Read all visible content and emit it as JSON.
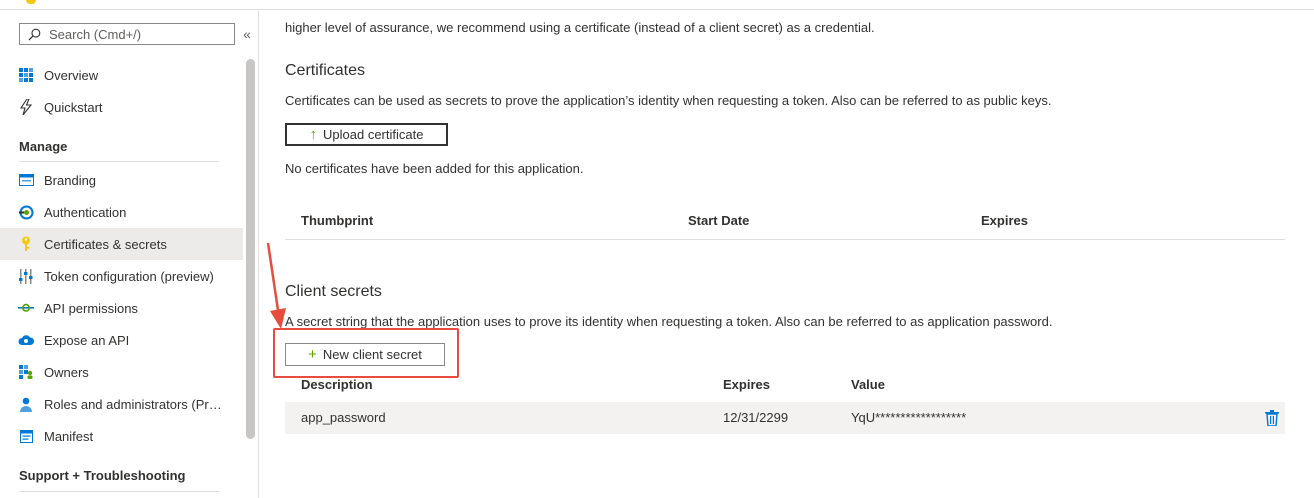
{
  "sidebar": {
    "search_placeholder": "Search (Cmd+/)",
    "collapse_glyph": "«",
    "items_top": [
      {
        "label": "Overview",
        "icon": "grid-icon"
      },
      {
        "label": "Quickstart",
        "icon": "lightning-icon"
      }
    ],
    "manage_header": "Manage",
    "manage_items": [
      {
        "label": "Branding",
        "icon": "branding-icon"
      },
      {
        "label": "Authentication",
        "icon": "authentication-icon"
      },
      {
        "label": "Certificates & secrets",
        "icon": "key-icon"
      },
      {
        "label": "Token configuration (preview)",
        "icon": "sliders-icon"
      },
      {
        "label": "API permissions",
        "icon": "api-icon"
      },
      {
        "label": "Expose an API",
        "icon": "cloud-icon"
      },
      {
        "label": "Owners",
        "icon": "owners-icon"
      },
      {
        "label": "Roles and administrators (Preview)",
        "icon": "roles-icon"
      },
      {
        "label": "Manifest",
        "icon": "manifest-icon"
      }
    ],
    "support_header": "Support + Troubleshooting"
  },
  "main": {
    "intro_text": "higher level of assurance, we recommend using a certificate (instead of a client secret) as a credential.",
    "certificates": {
      "title": "Certificates",
      "description": "Certificates can be used as secrets to prove the application’s identity when requesting a token. Also can be referred to as public keys.",
      "upload_label": "Upload certificate",
      "empty_text": "No certificates have been added for this application.",
      "columns": [
        "Thumbprint",
        "Start Date",
        "Expires"
      ]
    },
    "secrets": {
      "title": "Client secrets",
      "description": "A secret string that the application uses to prove its identity when requesting a token. Also can be referred to as application password.",
      "new_label": "New client secret",
      "columns": [
        "Description",
        "Expires",
        "Value"
      ],
      "rows": [
        {
          "description": "app_password",
          "expires": "12/31/2299",
          "value": "YqU******************"
        }
      ]
    }
  },
  "colors": {
    "accent_green": "#57a300",
    "annotation_red": "#e74c3c",
    "active_bg": "#edebe9",
    "trash_blue": "#0078d4"
  }
}
